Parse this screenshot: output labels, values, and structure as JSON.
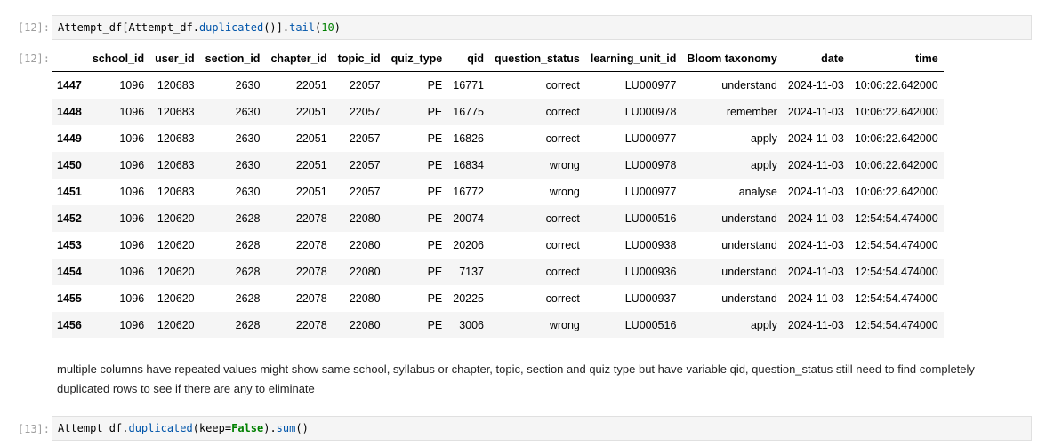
{
  "cell12": {
    "in_prompt": "[12]:",
    "out_prompt": "[12]:",
    "code_tokens": [
      {
        "t": "Attempt_df[Attempt_df.",
        "c": "tok-default"
      },
      {
        "t": "duplicated",
        "c": "tok-fn"
      },
      {
        "t": "()].",
        "c": "tok-default"
      },
      {
        "t": "tail",
        "c": "tok-fn"
      },
      {
        "t": "(",
        "c": "tok-default"
      },
      {
        "t": "10",
        "c": "tok-num"
      },
      {
        "t": ")",
        "c": "tok-default"
      }
    ]
  },
  "table": {
    "columns": [
      "",
      "school_id",
      "user_id",
      "section_id",
      "chapter_id",
      "topic_id",
      "quiz_type",
      "qid",
      "question_status",
      "learning_unit_id",
      "Bloom taxonomy",
      "date",
      "time"
    ],
    "rows": [
      [
        "1447",
        "1096",
        "120683",
        "2630",
        "22051",
        "22057",
        "PE",
        "16771",
        "correct",
        "LU000977",
        "understand",
        "2024-11-03",
        "10:06:22.642000"
      ],
      [
        "1448",
        "1096",
        "120683",
        "2630",
        "22051",
        "22057",
        "PE",
        "16775",
        "correct",
        "LU000978",
        "remember",
        "2024-11-03",
        "10:06:22.642000"
      ],
      [
        "1449",
        "1096",
        "120683",
        "2630",
        "22051",
        "22057",
        "PE",
        "16826",
        "correct",
        "LU000977",
        "apply",
        "2024-11-03",
        "10:06:22.642000"
      ],
      [
        "1450",
        "1096",
        "120683",
        "2630",
        "22051",
        "22057",
        "PE",
        "16834",
        "wrong",
        "LU000978",
        "apply",
        "2024-11-03",
        "10:06:22.642000"
      ],
      [
        "1451",
        "1096",
        "120683",
        "2630",
        "22051",
        "22057",
        "PE",
        "16772",
        "wrong",
        "LU000977",
        "analyse",
        "2024-11-03",
        "10:06:22.642000"
      ],
      [
        "1452",
        "1096",
        "120620",
        "2628",
        "22078",
        "22080",
        "PE",
        "20074",
        "correct",
        "LU000516",
        "understand",
        "2024-11-03",
        "12:54:54.474000"
      ],
      [
        "1453",
        "1096",
        "120620",
        "2628",
        "22078",
        "22080",
        "PE",
        "20206",
        "correct",
        "LU000938",
        "understand",
        "2024-11-03",
        "12:54:54.474000"
      ],
      [
        "1454",
        "1096",
        "120620",
        "2628",
        "22078",
        "22080",
        "PE",
        "7137",
        "correct",
        "LU000936",
        "understand",
        "2024-11-03",
        "12:54:54.474000"
      ],
      [
        "1455",
        "1096",
        "120620",
        "2628",
        "22078",
        "22080",
        "PE",
        "20225",
        "correct",
        "LU000937",
        "understand",
        "2024-11-03",
        "12:54:54.474000"
      ],
      [
        "1456",
        "1096",
        "120620",
        "2628",
        "22078",
        "22080",
        "PE",
        "3006",
        "wrong",
        "LU000516",
        "apply",
        "2024-11-03",
        "12:54:54.474000"
      ]
    ]
  },
  "markdown_text": "multiple columns have repeated values might show same school, syllabus or chapter, topic, section and quiz type but have variable qid, question_status still need to find completely duplicated rows to see if there are any to eliminate",
  "cell13": {
    "in_prompt": "[13]:",
    "code_tokens": [
      {
        "t": "Attempt_df.",
        "c": "tok-default"
      },
      {
        "t": "duplicated",
        "c": "tok-fn"
      },
      {
        "t": "(keep=",
        "c": "tok-default"
      },
      {
        "t": "False",
        "c": "tok-kw"
      },
      {
        "t": ").",
        "c": "tok-default"
      },
      {
        "t": "sum",
        "c": "tok-fn"
      },
      {
        "t": "()",
        "c": "tok-default"
      }
    ]
  }
}
